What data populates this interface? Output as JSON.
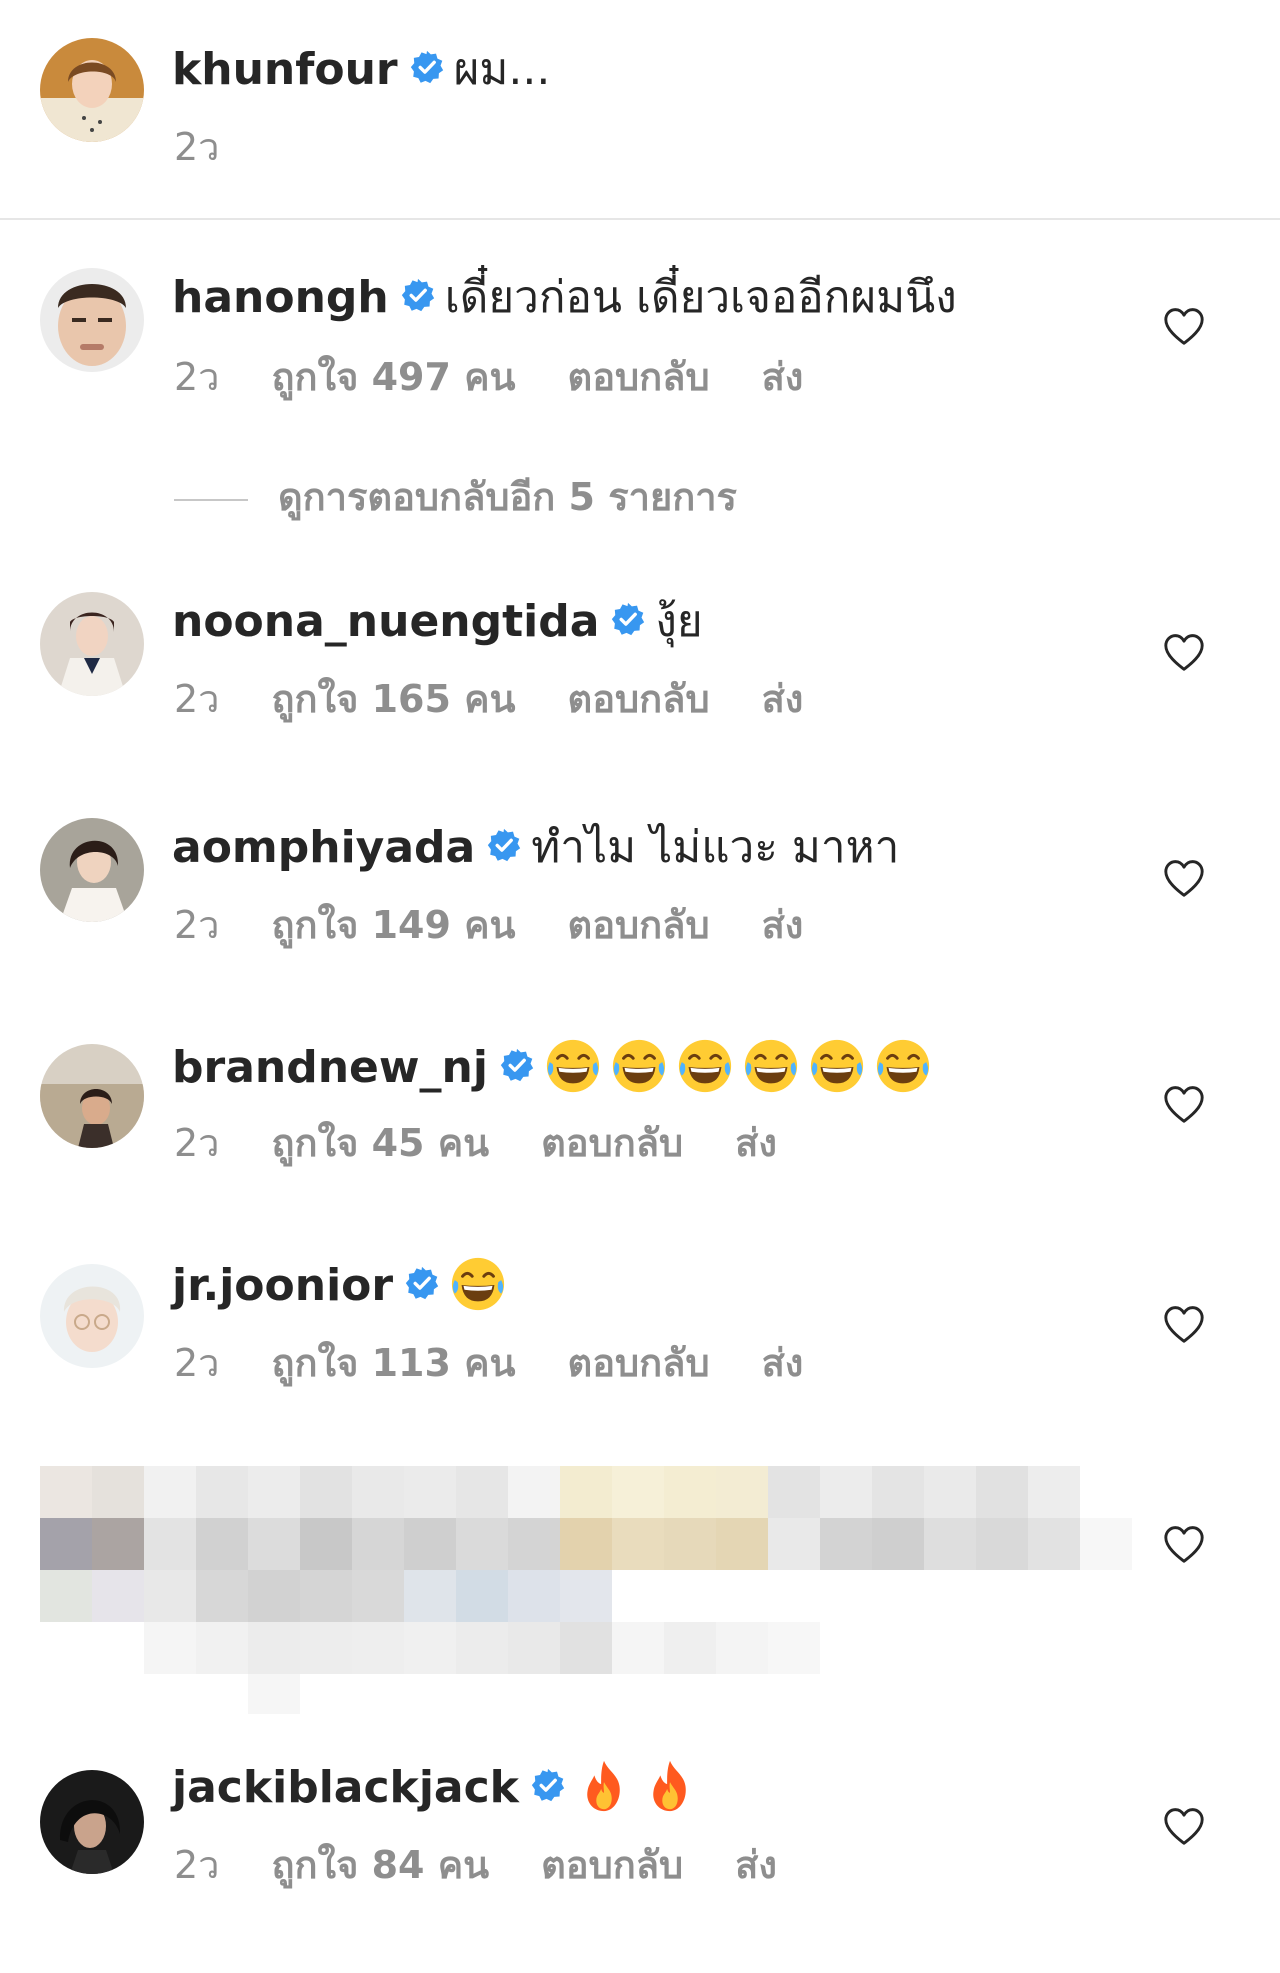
{
  "comments": [
    {
      "username": "khunfour",
      "text": "ผม...",
      "time": "2ว"
    },
    {
      "username": "hanongh",
      "text": "เดี๋ยวก่อน เดี๋ยวเจออีกผมนึง",
      "time": "2ว",
      "likes": "ถูกใจ 497 คน",
      "reply": "ตอบกลับ",
      "send": "ส่ง"
    },
    {
      "username": "noona_nuengtida",
      "text": "งุ้ย",
      "time": "2ว",
      "likes": "ถูกใจ 165 คน",
      "reply": "ตอบกลับ",
      "send": "ส่ง"
    },
    {
      "username": "aomphiyada",
      "text": "ทำไม ไม่แวะ มาหา",
      "time": "2ว",
      "likes": "ถูกใจ 149 คน",
      "reply": "ตอบกลับ",
      "send": "ส่ง"
    },
    {
      "username": "brandnew_nj",
      "text": "",
      "emoji": "face-with-tears-of-joy x6",
      "time": "2ว",
      "likes": "ถูกใจ 45 คน",
      "reply": "ตอบกลับ",
      "send": "ส่ง"
    },
    {
      "username": "jr.joonior",
      "text": "",
      "emoji": "face-with-tears-of-joy x1",
      "time": "2ว",
      "likes": "ถูกใจ 113 คน",
      "reply": "ตอบกลับ",
      "send": "ส่ง"
    },
    {
      "username": "jackiblackjack",
      "text": "",
      "emoji": "fire x2",
      "time": "2ว",
      "likes": "ถูกใจ 84 คน",
      "reply": "ตอบกลับ",
      "send": "ส่ง"
    }
  ],
  "view_replies": "ดูการตอบกลับอีก 5 รายการ",
  "colors": {
    "verified": "#3897f0",
    "meta": "#8e8e8e",
    "text": "#262626"
  },
  "icons": {
    "verified": "verified-badge-icon",
    "heart": "heart-outline-icon"
  }
}
